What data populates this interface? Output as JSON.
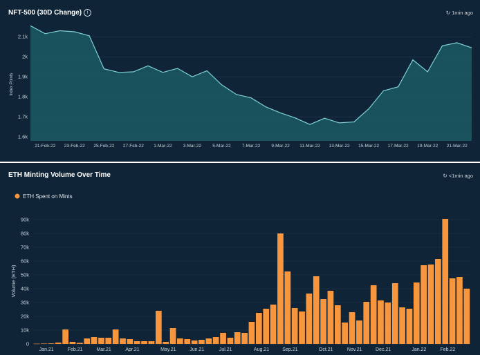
{
  "panels": [
    {
      "title": "NFT-500 (30D Change)",
      "updated": "1min ago"
    },
    {
      "title": "ETH Minting Volume Over Time",
      "updated": "<1min ago"
    }
  ],
  "chart_data": [
    {
      "type": "area",
      "title": "NFT-500 (30D Change)",
      "xlabel": "",
      "ylabel": "Index Points",
      "ylim": [
        1.58,
        2.18
      ],
      "yticks": [
        1.6,
        1.7,
        1.8,
        1.9,
        2.0,
        2.1
      ],
      "ytick_labels": [
        "1.6k",
        "1.7k",
        "1.8k",
        "1.9k",
        "2k",
        "2.1k"
      ],
      "xtick_labels": [
        "21-Feb-22",
        "23-Feb-22",
        "25-Feb-22",
        "27-Feb-22",
        "1-Mar-22",
        "3-Mar-22",
        "5-Mar-22",
        "7-Mar-22",
        "9-Mar-22",
        "11-Mar-22",
        "13-Mar-22",
        "15-Mar-22",
        "17-Mar-22",
        "19-Mar-22",
        "21-Mar-22"
      ],
      "values": [
        2.155,
        2.115,
        2.13,
        2.125,
        2.105,
        1.94,
        1.922,
        1.925,
        1.955,
        1.922,
        1.942,
        1.9,
        1.93,
        1.86,
        1.812,
        1.795,
        1.75,
        1.72,
        1.695,
        1.662,
        1.693,
        1.67,
        1.675,
        1.74,
        1.83,
        1.85,
        1.985,
        1.925,
        2.055,
        2.07,
        2.045
      ],
      "line_color": "#7fd1d6",
      "fill_color": "#1b5a63"
    },
    {
      "type": "bar",
      "title": "ETH Minting Volume Over Time",
      "xlabel": "",
      "ylabel": "Volume (ETH)",
      "ylim": [
        0,
        95000
      ],
      "yticks": [
        0,
        10000,
        20000,
        30000,
        40000,
        50000,
        60000,
        70000,
        80000,
        90000
      ],
      "ytick_labels": [
        "0",
        "10k",
        "20k",
        "30k",
        "40k",
        "50k",
        "60k",
        "70k",
        "80k",
        "90k"
      ],
      "xtick_labels": [
        "Jan.21",
        "Feb.21",
        "Mar.21",
        "Apr.21",
        "May.21",
        "Jun.21",
        "Jul.21",
        "Aug.21",
        "Sep.21",
        "Oct.21",
        "Nov.21",
        "Dec.21",
        "Jan.22",
        "Feb.22"
      ],
      "legend": "top-left",
      "series": [
        {
          "name": "ETH Spent on Mints",
          "color": "#f7963d",
          "values": [
            200,
            300,
            400,
            1000,
            10500,
            1500,
            800,
            4000,
            5000,
            4500,
            4500,
            10500,
            4000,
            3500,
            2000,
            2000,
            2000,
            24000,
            1500,
            11500,
            4000,
            3500,
            2500,
            3000,
            4000,
            5000,
            8000,
            4500,
            8500,
            8000,
            16000,
            22500,
            25500,
            28500,
            80000,
            52500,
            26000,
            23500,
            36500,
            49000,
            32500,
            38500,
            28000,
            15500,
            23000,
            17000,
            30500,
            42500,
            31500,
            30000,
            44000,
            26500,
            25500,
            44500,
            57000,
            57500,
            61500,
            90500,
            47500,
            48500,
            40000
          ]
        }
      ]
    }
  ]
}
